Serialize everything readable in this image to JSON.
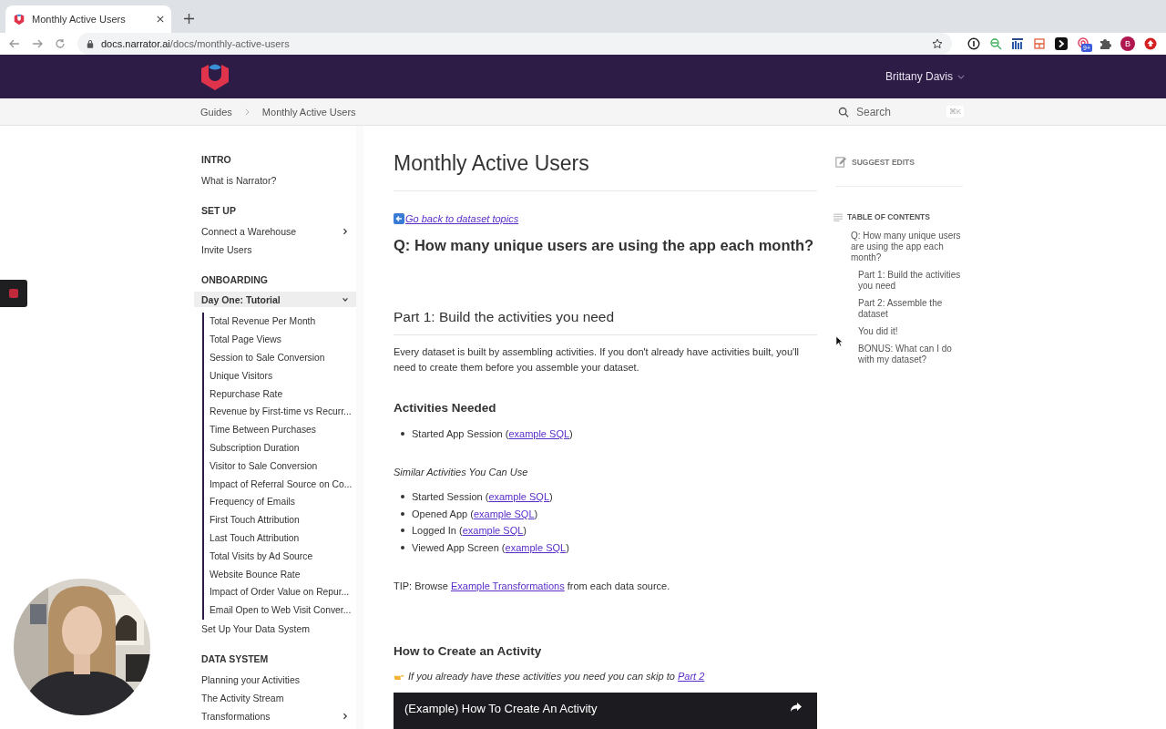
{
  "browser": {
    "tab": {
      "title": "Monthly Active Users",
      "selected": true
    },
    "url_host": "docs.narrator.ai",
    "url_path": "/docs/monthly-active-users",
    "extension_badge": "9+",
    "profile_initial": "B"
  },
  "header": {
    "user_name": "Brittany Davis"
  },
  "breadcrumbs": [
    "Guides",
    "Monthly Active Users"
  ],
  "search": {
    "placeholder": "Search",
    "shortcut": "⌘K"
  },
  "sidebar": [
    {
      "heading": "INTRO",
      "items": [
        {
          "kind": "link",
          "label": "What is Narrator?",
          "selected": false
        }
      ]
    },
    {
      "heading": "SET UP",
      "items": [
        {
          "kind": "group",
          "label": "Connect a Warehouse",
          "selected": false,
          "expanded": false
        },
        {
          "kind": "link",
          "label": "Invite Users",
          "selected": false
        }
      ]
    },
    {
      "heading": "ONBOARDING",
      "items": [
        {
          "kind": "group",
          "label": "Day One: Tutorial",
          "selected": true,
          "expanded": true,
          "children": [
            "Total Revenue Per Month",
            "Total Page Views",
            "Session to Sale Conversion",
            "Unique Visitors",
            "Repurchase Rate",
            "Revenue by First-time vs Recurr...",
            "Time Between Purchases",
            "Subscription Duration",
            "Visitor to Sale Conversion",
            "Impact of Referral Source on Co...",
            "Frequency of Emails",
            "First Touch Attribution",
            "Last Touch Attribution",
            "Total Visits by Ad Source",
            "Website Bounce Rate",
            "Impact of Order Value on Repur...",
            "Email Open to Web Visit Conver..."
          ]
        },
        {
          "kind": "link",
          "label": "Set Up Your Data System",
          "selected": false
        }
      ]
    },
    {
      "heading": "DATA SYSTEM",
      "items": [
        {
          "kind": "link",
          "label": "Planning your Activities",
          "selected": false
        },
        {
          "kind": "link",
          "label": "The Activity Stream",
          "selected": false
        },
        {
          "kind": "group",
          "label": "Transformations",
          "selected": false,
          "expanded": false
        }
      ]
    }
  ],
  "page": {
    "title": "Monthly Active Users",
    "suggest_edits": "SUGGEST EDITS",
    "blocks": [
      {
        "kind": "back-link",
        "link": "Go back to dataset topics"
      },
      {
        "kind": "question",
        "text": "Q: How many unique users are using the app each month?"
      },
      {
        "kind": "part",
        "text": "Part 1: Build the activities you need"
      },
      {
        "kind": "paragraph",
        "text": "Every dataset is built by assembling activities. If you don't already have activities built, you'll need to create them before you assemble your dataset."
      },
      {
        "kind": "subheading",
        "text": "Activities Needed"
      },
      {
        "kind": "list",
        "items": [
          {
            "text": "Started App Session (",
            "link": "example SQL",
            "after": ")"
          }
        ]
      },
      {
        "kind": "italic",
        "text": "Similar Activities You Can Use"
      },
      {
        "kind": "list",
        "items": [
          {
            "text": "Started Session (",
            "link": "example SQL",
            "after": ")"
          },
          {
            "text": "Opened App (",
            "link": "example SQL",
            "after": ")"
          },
          {
            "text": "Logged In (",
            "link": "example SQL",
            "after": ")"
          },
          {
            "text": "Viewed App Screen (",
            "link": "example SQL",
            "after": ")"
          }
        ]
      },
      {
        "kind": "tip",
        "text": "TIP: Browse ",
        "link": "Example Transformations",
        "after": " from each data source."
      },
      {
        "kind": "subheading",
        "text": "How to Create an Activity"
      },
      {
        "kind": "note",
        "text": "If you already have these activities you need you can skip to ",
        "link": "Part 2"
      },
      {
        "kind": "video",
        "title": "(Example) How To Create An Activity"
      }
    ]
  },
  "toc": {
    "title": "TABLE OF CONTENTS",
    "items": [
      {
        "label": "Q: How many unique users are using the app each month?",
        "children": [
          {
            "label": "Part 1: Build the activities you need"
          },
          {
            "label": "Part 2: Assemble the dataset"
          },
          {
            "label": "You did it!"
          },
          {
            "label": "BONUS: What can I do with my dataset?"
          }
        ]
      }
    ]
  },
  "webcam": {
    "kind": "picture"
  }
}
